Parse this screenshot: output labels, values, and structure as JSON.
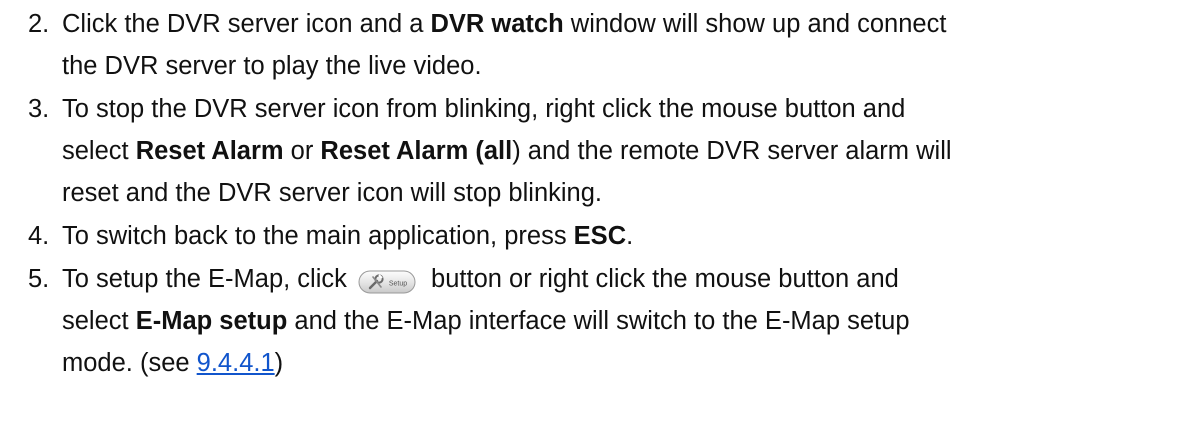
{
  "steps": [
    {
      "number": "2.",
      "lines": [
        [
          "Click the DVR server icon and a ",
          {
            "b": "DVR watch"
          },
          " window will show up and connect"
        ],
        [
          "the DVR server to play the live video."
        ]
      ]
    },
    {
      "number": "3.",
      "lines": [
        [
          "To stop the DVR server icon from blinking, right click the mouse button and"
        ],
        [
          "select ",
          {
            "b": "Reset Alarm"
          },
          " or ",
          {
            "b": "Reset Alarm (all"
          },
          ") and the remote DVR server alarm will"
        ],
        [
          "reset and the DVR server icon will stop blinking."
        ]
      ]
    },
    {
      "number": "4.",
      "lines": [
        [
          "To switch back to the main application, press ",
          {
            "b": "ESC"
          },
          "."
        ]
      ]
    },
    {
      "number": "5.",
      "lines": [
        [
          "To setup the E-Map, click ",
          {
            "icon": "setup-button"
          },
          " button or right click the mouse button and"
        ],
        [
          "select ",
          {
            "b": "E-Map setup"
          },
          " and the E-Map interface will switch to the E-Map setup"
        ],
        [
          "mode. (see ",
          {
            "link": "9.4.4.1"
          },
          ")"
        ]
      ]
    }
  ],
  "setup_button": {
    "label": "Setup",
    "icon": "wrench-icon"
  },
  "colors": {
    "text": "#111111",
    "link": "#1155cc"
  }
}
